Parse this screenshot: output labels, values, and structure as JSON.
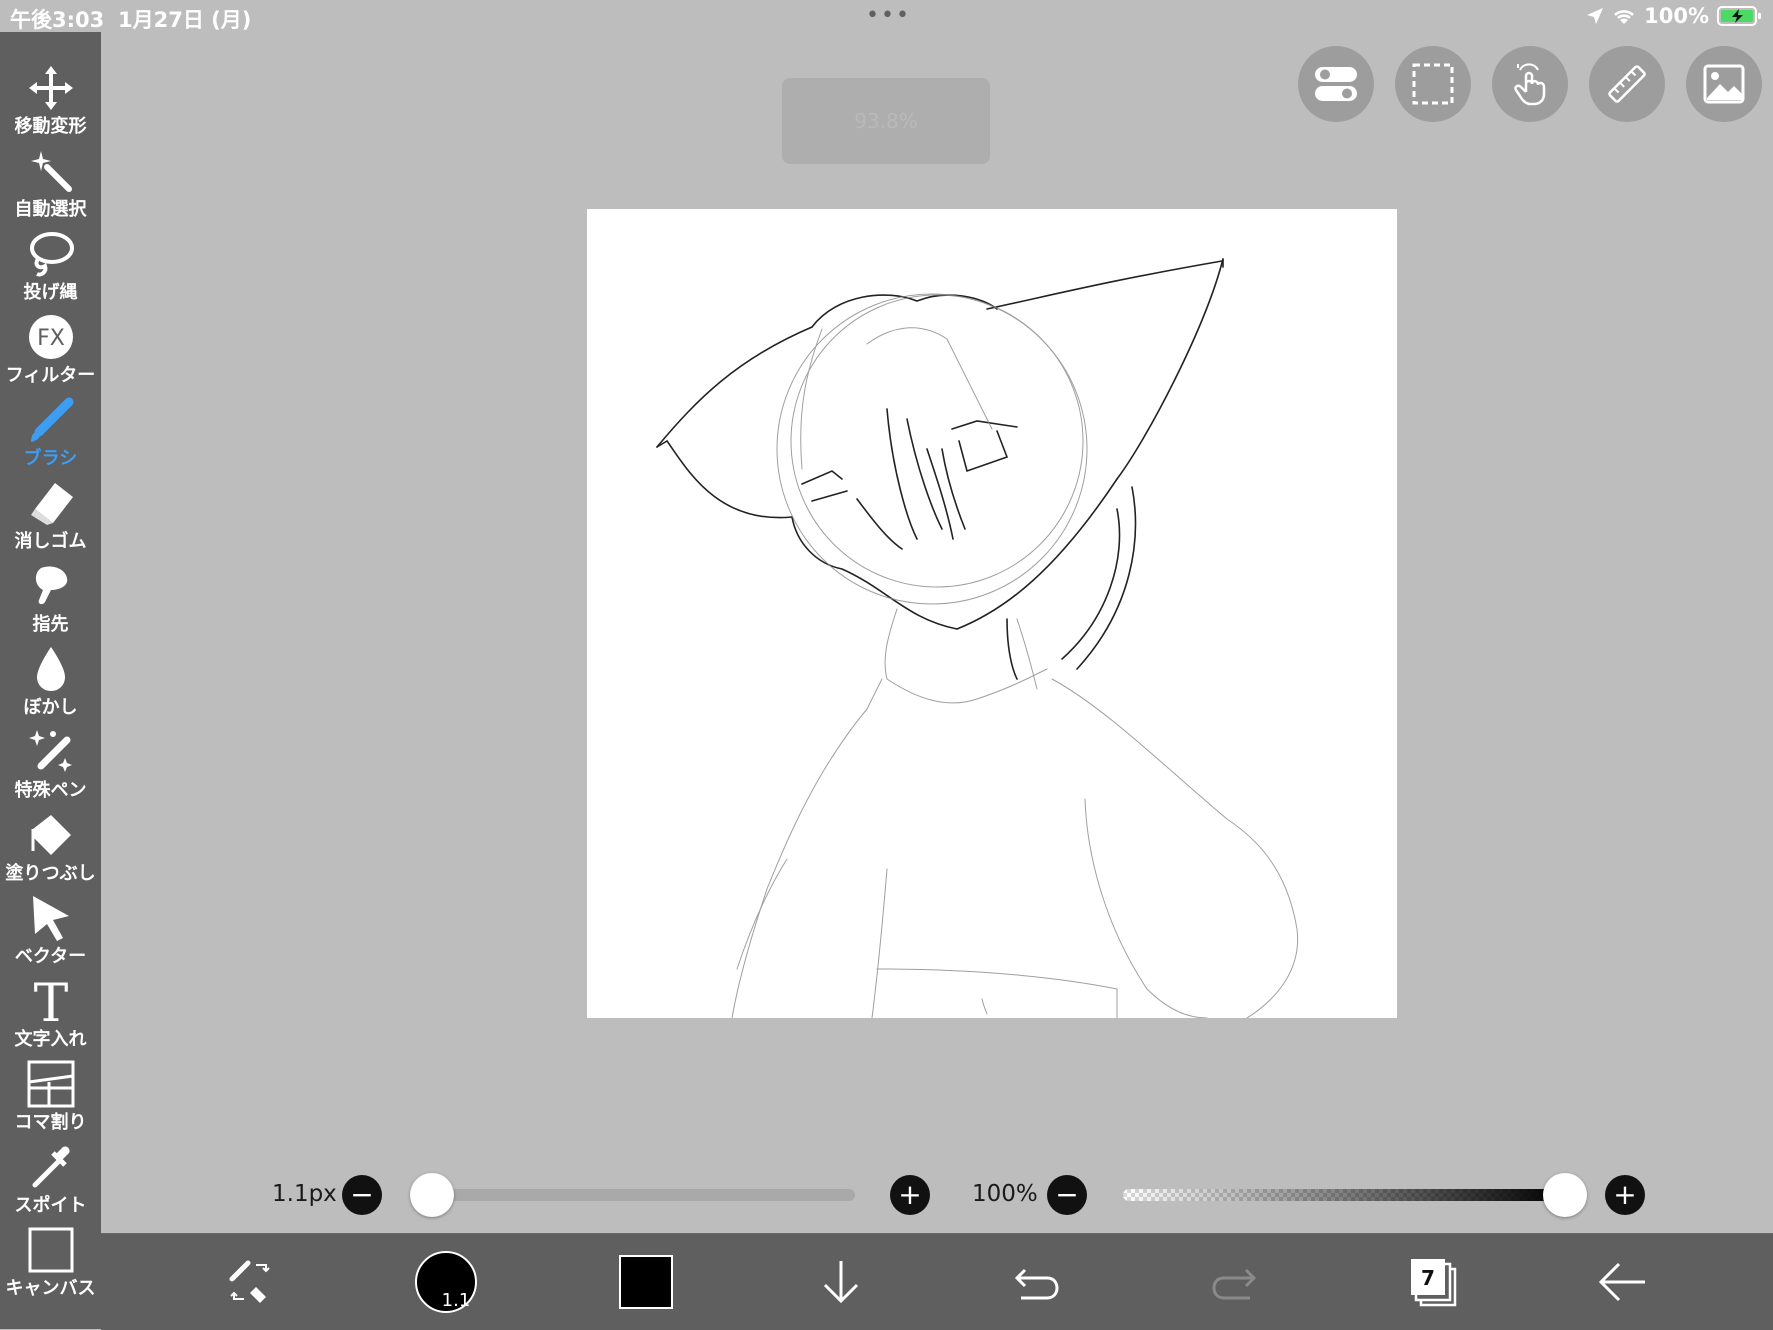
{
  "status": {
    "time": "午後3:03",
    "date": "1月27日 (月)",
    "dots": "•••",
    "battery": "100%"
  },
  "toolbar": {
    "items": [
      {
        "label": "移動変形",
        "icon": "move-arrows-icon"
      },
      {
        "label": "自動選択",
        "icon": "magic-wand-icon"
      },
      {
        "label": "投げ縄",
        "icon": "lasso-icon"
      },
      {
        "label": "フィルター",
        "icon": "fx-icon"
      },
      {
        "label": "ブラシ",
        "icon": "brush-icon",
        "active": true
      },
      {
        "label": "消しゴム",
        "icon": "eraser-icon"
      },
      {
        "label": "指先",
        "icon": "finger-icon"
      },
      {
        "label": "ぼかし",
        "icon": "drop-icon"
      },
      {
        "label": "特殊ペン",
        "icon": "sparkle-pen-icon"
      },
      {
        "label": "塗りつぶし",
        "icon": "fill-icon"
      },
      {
        "label": "ベクター",
        "icon": "vector-cursor-icon"
      },
      {
        "label": "文字入れ",
        "icon": "text-icon"
      },
      {
        "label": "コマ割り",
        "icon": "panel-icon"
      },
      {
        "label": "スポイト",
        "icon": "eyedropper-icon"
      },
      {
        "label": "キャンバス",
        "icon": "canvas-icon"
      }
    ]
  },
  "zoom_indicator": "93.8%",
  "brush": {
    "size_label": "1.1px",
    "size_fraction": 0.0,
    "opacity_label": "100%",
    "opacity_fraction": 1.0,
    "circle_size": "1.1"
  },
  "layers_count": "7",
  "colors": {
    "sidebar": "#5f5f5f",
    "background": "#bdbdbd",
    "accent": "#3d9df3",
    "current_color": "#000000"
  }
}
